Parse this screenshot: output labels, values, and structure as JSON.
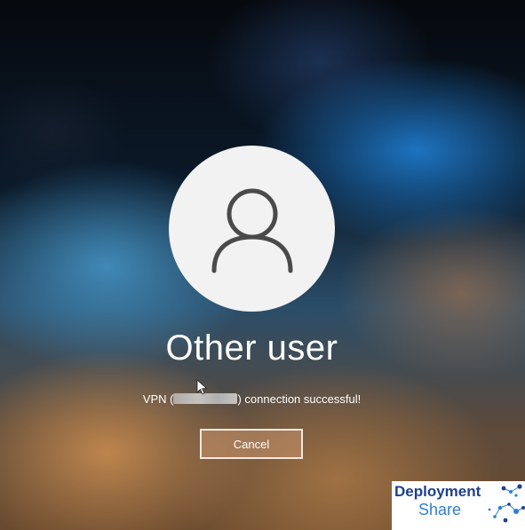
{
  "lock_screen": {
    "user_name": "Other user",
    "status": {
      "prefix": "VPN (",
      "suffix": ") connection successful!"
    },
    "cancel_label": "Cancel"
  },
  "watermark": {
    "line1": "Deployment",
    "line2": "Share"
  },
  "colors": {
    "avatar_bg": "#f2f2f2",
    "avatar_glyph": "#4a4a4a",
    "logo_dark": "#1e3f8f",
    "logo_light": "#2f7fd0"
  },
  "icons": {
    "avatar": "user-silhouette-icon",
    "cursor": "mouse-pointer-icon",
    "logo": "network-dots-icon"
  }
}
